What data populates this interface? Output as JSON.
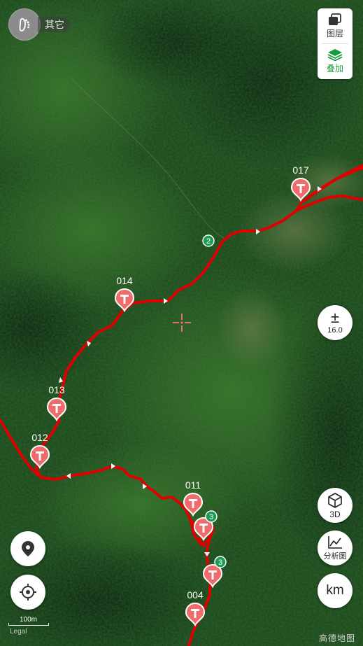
{
  "colors": {
    "track": "#e00000",
    "marker": "#f06b6b",
    "badge_green": "#1d9a54",
    "overlay_active": "#1a9b3c"
  },
  "mode_badge": {
    "label": "其它",
    "icon": "footprint-icon"
  },
  "layer_panel": {
    "layers_label": "图层",
    "overlay_label": "叠加"
  },
  "zoom_control": {
    "level": "16.0"
  },
  "buttons": {
    "three_d": "3D",
    "analysis": "分析图",
    "units": "km"
  },
  "left_buttons": {
    "poi": "location-pin-icon",
    "locate": "gps-target-icon"
  },
  "scale_bar": {
    "label": "100m"
  },
  "legal_label": "Legal",
  "brand_label": "高德地图",
  "waypoints": [
    {
      "label": "017"
    },
    {
      "label": "014"
    },
    {
      "label": "013"
    },
    {
      "label": "012"
    },
    {
      "label": "011"
    },
    {
      "label": "004"
    }
  ],
  "cluster_badges": [
    {
      "count": "2"
    },
    {
      "count": "3"
    },
    {
      "count": "3"
    }
  ]
}
